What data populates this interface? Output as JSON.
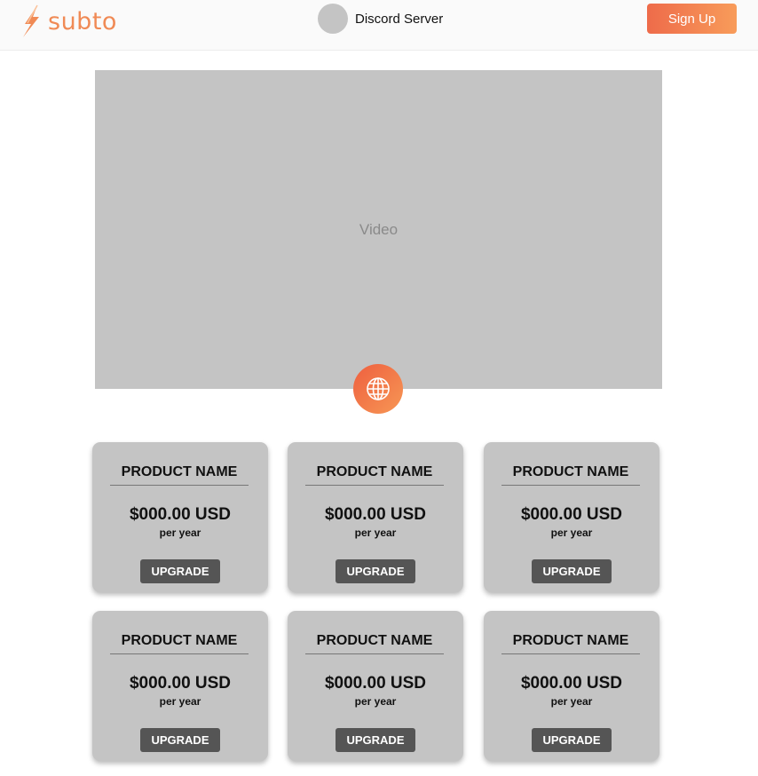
{
  "header": {
    "logo_text": "subto",
    "server_name": "Discord Server",
    "signup_label": "Sign Up"
  },
  "video": {
    "label": "Video"
  },
  "products": [
    {
      "name": "PRODUCT NAME",
      "price": "$000.00 USD",
      "period": "per year",
      "button": "UPGRADE"
    },
    {
      "name": "PRODUCT NAME",
      "price": "$000.00 USD",
      "period": "per year",
      "button": "UPGRADE"
    },
    {
      "name": "PRODUCT NAME",
      "price": "$000.00 USD",
      "period": "per year",
      "button": "UPGRADE"
    },
    {
      "name": "PRODUCT NAME",
      "price": "$000.00 USD",
      "period": "per year",
      "button": "UPGRADE"
    },
    {
      "name": "PRODUCT NAME",
      "price": "$000.00 USD",
      "period": "per year",
      "button": "UPGRADE"
    },
    {
      "name": "PRODUCT NAME",
      "price": "$000.00 USD",
      "period": "per year",
      "button": "UPGRADE"
    }
  ],
  "colors": {
    "accent_start": "#ee6b4a",
    "accent_end": "#f89c5a",
    "placeholder_gray": "#c4c4c4",
    "button_dark": "#555555"
  },
  "icons": {
    "logo": "lightning-bolt-icon",
    "globe": "globe-icon"
  }
}
